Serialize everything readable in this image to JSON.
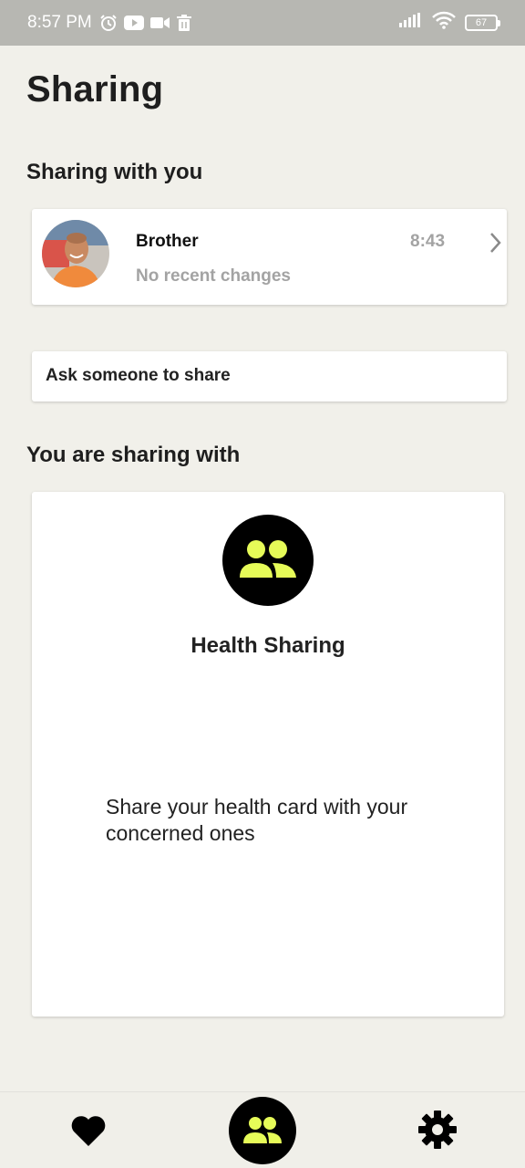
{
  "status_bar": {
    "time": "8:57 PM",
    "icons": [
      "alarm-icon",
      "youtube-icon",
      "video-camera-icon",
      "trash-icon"
    ],
    "right_icons": [
      "signal-icon",
      "wifi-icon"
    ],
    "battery": "67"
  },
  "page": {
    "title": "Sharing"
  },
  "sharing_with_you": {
    "heading": "Sharing with you",
    "contacts": [
      {
        "name": "Brother",
        "status": "No recent changes",
        "time": "8:43"
      }
    ],
    "ask_label": "Ask someone to share"
  },
  "you_are_sharing": {
    "heading": "You are sharing with",
    "card_title": "Health Sharing",
    "card_description": "Share your health card with your concerned ones"
  },
  "bottom_nav": {
    "items": [
      "heart-icon",
      "people-icon",
      "gear-icon"
    ],
    "active": "people-icon"
  },
  "colors": {
    "background": "#f1f0ea",
    "accent": "#e6fb58",
    "status_bar": "#b7b7b2",
    "muted_text": "#a3a3a3"
  }
}
